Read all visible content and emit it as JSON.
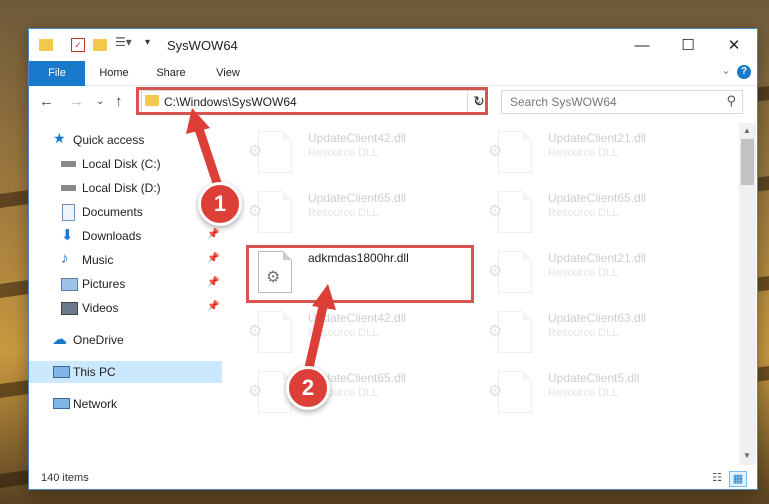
{
  "window": {
    "title": "SysWOW64",
    "minimize_glyph": "—",
    "maximize_glyph": "☐",
    "close_glyph": "✕"
  },
  "ribbon": {
    "tabs": [
      "File",
      "Home",
      "Share",
      "View"
    ]
  },
  "address": {
    "path": "C:\\Windows\\SysWOW64"
  },
  "search": {
    "placeholder": "Search SysWOW64"
  },
  "sidebar": {
    "items": [
      {
        "label": "Quick access",
        "icon": "star-icon",
        "pinned": false
      },
      {
        "label": "Local Disk (C:)",
        "icon": "drive-icon",
        "pinned": false
      },
      {
        "label": "Local Disk (D:)",
        "icon": "drive-icon",
        "pinned": false
      },
      {
        "label": "Documents",
        "icon": "documents-icon",
        "pinned": true
      },
      {
        "label": "Downloads",
        "icon": "download-icon",
        "pinned": true
      },
      {
        "label": "Music",
        "icon": "music-icon",
        "pinned": true
      },
      {
        "label": "Pictures",
        "icon": "pictures-icon",
        "pinned": true
      },
      {
        "label": "Videos",
        "icon": "videos-icon",
        "pinned": true
      },
      {
        "label": "OneDrive",
        "icon": "cloud-icon",
        "pinned": false
      },
      {
        "label": "This PC",
        "icon": "computer-icon",
        "pinned": false,
        "selected": true
      },
      {
        "label": "Network",
        "icon": "network-icon",
        "pinned": false
      }
    ]
  },
  "files": [
    {
      "name": "UpdateClient42.dll",
      "type": "Resource DLL"
    },
    {
      "name": "UpdateClient21.dll",
      "type": "Resource DLL"
    },
    {
      "name": "UpdateClient65.dll",
      "type": "Resource DLL"
    },
    {
      "name": "UpdateClient65.dll",
      "type": "Resource DLL"
    },
    {
      "name": "adkmdas1800hr.dll",
      "type": "",
      "highlighted": true
    },
    {
      "name": "UpdateClient21.dll",
      "type": "Resource DLL"
    },
    {
      "name": "UpdateClient42.dll",
      "type": "Resource DLL"
    },
    {
      "name": "UpdateClient63.dll",
      "type": "Resource DLL"
    },
    {
      "name": "UpdateClient65.dll",
      "type": "Resource DLL"
    },
    {
      "name": "UpdateClient5.dll",
      "type": "Resource DLL"
    }
  ],
  "status": {
    "item_count": "140 items"
  },
  "callouts": [
    "1",
    "2"
  ],
  "colors": {
    "accent": "#1979ca",
    "highlight": "#d9534f",
    "selected": "#cce8ff"
  }
}
